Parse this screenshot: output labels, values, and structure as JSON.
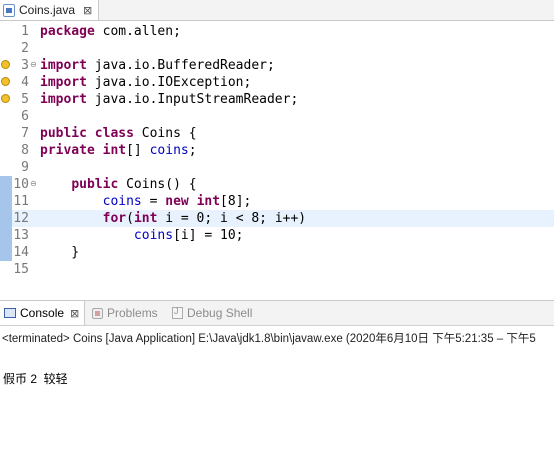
{
  "editor": {
    "tab_label": "Coins.java",
    "tab_close": "⊠"
  },
  "code": [
    {
      "no": "1",
      "tokens": [
        {
          "t": "package",
          "c": "kw"
        },
        {
          "t": " com.allen;"
        }
      ]
    },
    {
      "no": "2",
      "tokens": []
    },
    {
      "no": "3",
      "marker": "warning",
      "fold": "⊖",
      "tokens": [
        {
          "t": "import",
          "c": "kw"
        },
        {
          "t": " java.io.BufferedReader;"
        }
      ]
    },
    {
      "no": "4",
      "marker": "warning",
      "tokens": [
        {
          "t": "import",
          "c": "kw"
        },
        {
          "t": " java.io.IOException;"
        }
      ]
    },
    {
      "no": "5",
      "marker": "warning",
      "tokens": [
        {
          "t": "import",
          "c": "kw"
        },
        {
          "t": " java.io.InputStreamReader;"
        }
      ]
    },
    {
      "no": "6",
      "tokens": []
    },
    {
      "no": "7",
      "tokens": [
        {
          "t": "public",
          "c": "kw"
        },
        {
          "t": " "
        },
        {
          "t": "class",
          "c": "kw"
        },
        {
          "t": " Coins {"
        }
      ]
    },
    {
      "no": "8",
      "tokens": [
        {
          "t": "private",
          "c": "kw"
        },
        {
          "t": " "
        },
        {
          "t": "int",
          "c": "kw"
        },
        {
          "t": "[] "
        },
        {
          "t": "coins",
          "c": "fld"
        },
        {
          "t": ";"
        }
      ]
    },
    {
      "no": "9",
      "tokens": []
    },
    {
      "no": "10",
      "changed": true,
      "fold": "⊖",
      "tokens": [
        {
          "t": "    "
        },
        {
          "t": "public",
          "c": "kw"
        },
        {
          "t": " Coins() {"
        }
      ]
    },
    {
      "no": "11",
      "changed": true,
      "tokens": [
        {
          "t": "        "
        },
        {
          "t": "coins",
          "c": "fld"
        },
        {
          "t": " = "
        },
        {
          "t": "new",
          "c": "kw"
        },
        {
          "t": " "
        },
        {
          "t": "int",
          "c": "kw"
        },
        {
          "t": "[8];"
        }
      ]
    },
    {
      "no": "12",
      "changed": true,
      "current": true,
      "tokens": [
        {
          "t": "        "
        },
        {
          "t": "for",
          "c": "kw"
        },
        {
          "t": "("
        },
        {
          "t": "int",
          "c": "kw"
        },
        {
          "t": " i = 0; i < 8; i++)"
        }
      ]
    },
    {
      "no": "13",
      "changed": true,
      "tokens": [
        {
          "t": "            "
        },
        {
          "t": "coins",
          "c": "fld"
        },
        {
          "t": "[i] = 10;"
        }
      ]
    },
    {
      "no": "14",
      "changed": true,
      "tokens": [
        {
          "t": "    }"
        }
      ]
    },
    {
      "no": "15",
      "tokens": []
    }
  ],
  "views": {
    "tabs": {
      "console": "Console",
      "console_close": "⊠",
      "problems": "Problems",
      "debug_shell": "Debug Shell"
    },
    "status": "<terminated> Coins [Java Application] E:\\Java\\jdk1.8\\bin\\javaw.exe  (2020年6月10日 下午5:21:35 – 下午5",
    "output": "假币 2  较轻"
  },
  "colors": {
    "keyword": "#7f0055",
    "field": "#0000c0",
    "current_line": "#e8f2fe",
    "change_ruler": "#a5c5ea"
  }
}
